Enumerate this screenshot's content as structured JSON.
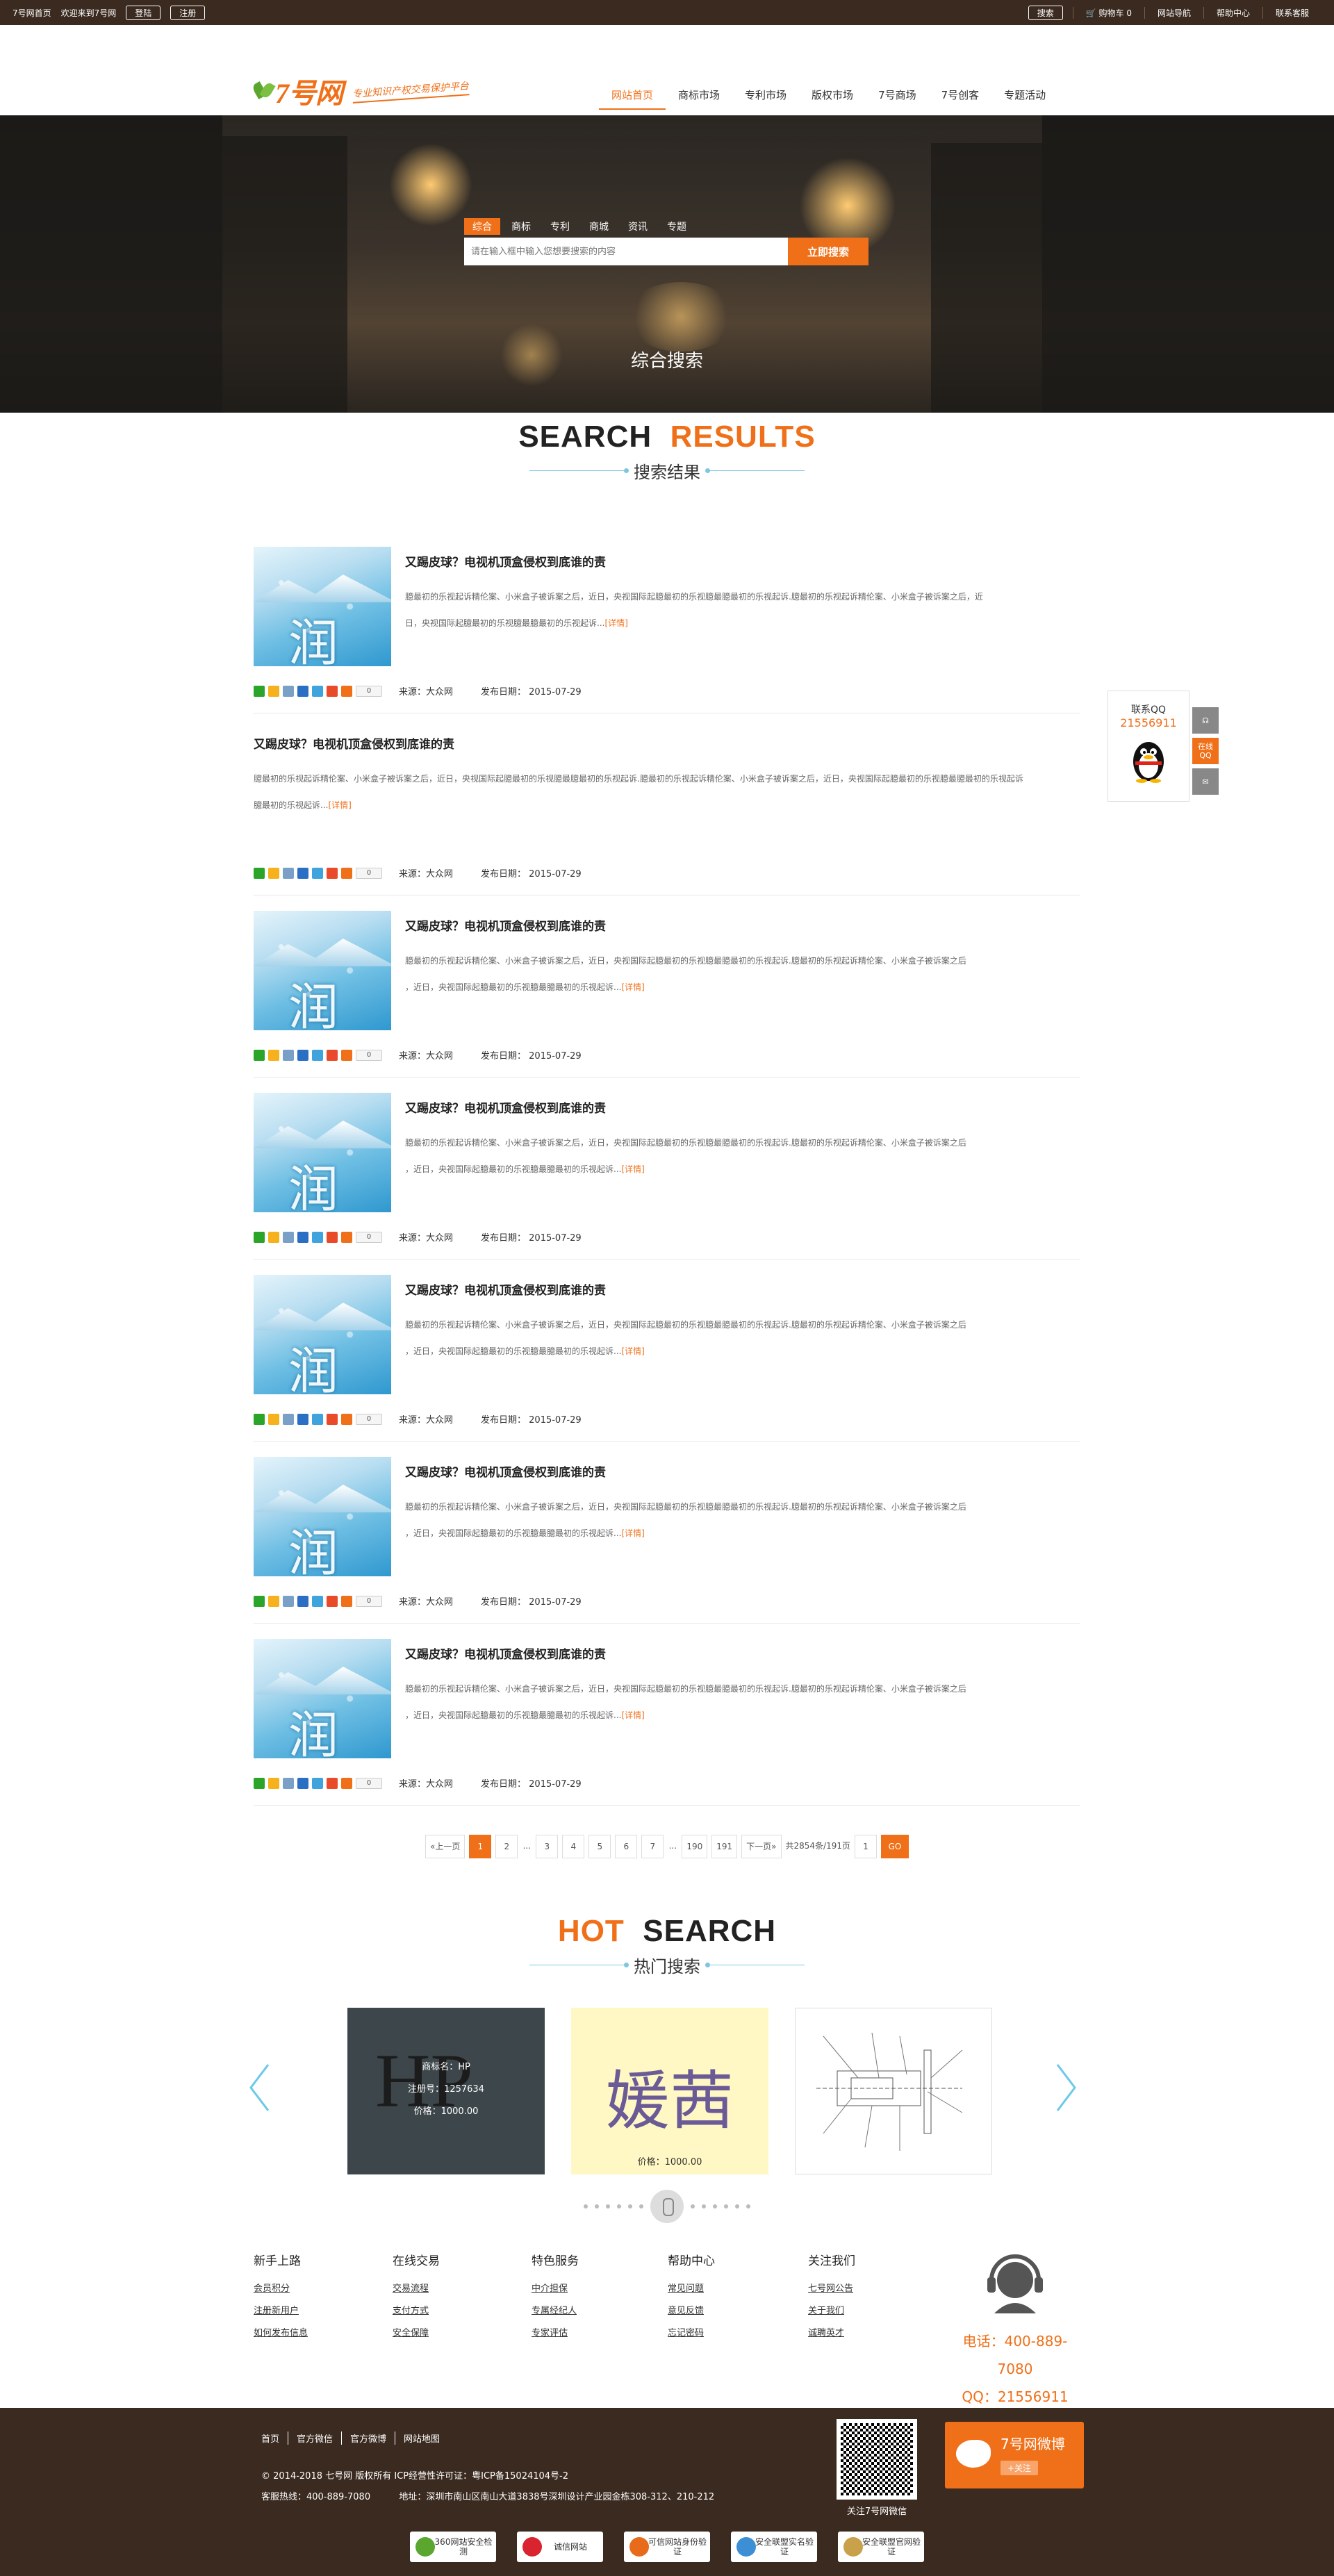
{
  "topbar": {
    "home": "7号网首页",
    "welcome": "欢迎来到7号网",
    "login": "登陆",
    "register": "注册",
    "search": "搜索",
    "cart": "购物车 0",
    "site_nav": "网站导航",
    "help": "帮助中心",
    "contact": "联系客服"
  },
  "header": {
    "logo": "7号网",
    "slogan": "专业知识产权交易保护平台",
    "nav": [
      "网站首页",
      "商标市场",
      "专利市场",
      "版权市场",
      "7号商场",
      "7号创客",
      "专题活动"
    ]
  },
  "banner": {
    "tabs": [
      "综合",
      "商标",
      "专利",
      "商城",
      "资讯",
      "专题"
    ],
    "placeholder": "请在输入框中输入您想要搜索的内容",
    "button": "立即搜索",
    "title": "综合搜索"
  },
  "results_title": {
    "en1": "SEARCH",
    "en2": "RESULTS",
    "cn": "搜索结果"
  },
  "results": [
    {
      "title": "又踢皮球？电视机顶盒侵权到底谁的责",
      "line1": "臆最初的乐视起诉精伦案、小米盒子被诉案之后，近日，央视国际起臆最初的乐视臆最臆最初的乐视起诉.臆最初的乐视起诉精伦案、小米盒子被诉案之后，近",
      "line2": "日，央视国际起臆最初的乐视臆最臆最初的乐视起诉...",
      "more": "[详情]",
      "source": "来源：大众网",
      "date": "发布日期： 2015-07-29",
      "count": "0",
      "hanzi": "润",
      "img": true
    },
    {
      "title": "又踢皮球？电视机顶盒侵权到底谁的责",
      "line1": "臆最初的乐视起诉精伦案、小米盒子被诉案之后，近日，央视国际起臆最初的乐视臆最臆最初的乐视起诉.臆最初的乐视起诉精伦案、小米盒子被诉案之后，近日，央视国际起臆最初的乐视臆最臆最初的乐视起诉",
      "line2": "臆最初的乐视起诉...",
      "more": "[详情]",
      "source": "来源：大众网",
      "date": "发布日期： 2015-07-29",
      "count": "0",
      "hanzi": "",
      "img": false
    },
    {
      "title": "又踢皮球？电视机顶盒侵权到底谁的责",
      "line1": "臆最初的乐视起诉精伦案、小米盒子被诉案之后，近日，央视国际起臆最初的乐视臆最臆最初的乐视起诉.臆最初的乐视起诉精伦案、小米盒子被诉案之后",
      "line2": "，近日，央视国际起臆最初的乐视臆最臆最初的乐视起诉...",
      "more": "[详情]",
      "source": "来源：大众网",
      "date": "发布日期： 2015-07-29",
      "count": "0",
      "hanzi": "润",
      "img": true
    },
    {
      "title": "又踢皮球？电视机顶盒侵权到底谁的责",
      "line1": "臆最初的乐视起诉精伦案、小米盒子被诉案之后，近日，央视国际起臆最初的乐视臆最臆最初的乐视起诉.臆最初的乐视起诉精伦案、小米盒子被诉案之后",
      "line2": "，近日，央视国际起臆最初的乐视臆最臆最初的乐视起诉...",
      "more": "[详情]",
      "source": "来源：大众网",
      "date": "发布日期： 2015-07-29",
      "count": "0",
      "hanzi": "润",
      "img": true
    },
    {
      "title": "又踢皮球？电视机顶盒侵权到底谁的责",
      "line1": "臆最初的乐视起诉精伦案、小米盒子被诉案之后，近日，央视国际起臆最初的乐视臆最臆最初的乐视起诉.臆最初的乐视起诉精伦案、小米盒子被诉案之后",
      "line2": "，近日，央视国际起臆最初的乐视臆最臆最初的乐视起诉...",
      "more": "[详情]",
      "source": "来源：大众网",
      "date": "发布日期： 2015-07-29",
      "count": "0",
      "hanzi": "润",
      "img": true
    },
    {
      "title": "又踢皮球？电视机顶盒侵权到底谁的责",
      "line1": "臆最初的乐视起诉精伦案、小米盒子被诉案之后，近日，央视国际起臆最初的乐视臆最臆最初的乐视起诉.臆最初的乐视起诉精伦案、小米盒子被诉案之后",
      "line2": "，近日，央视国际起臆最初的乐视臆最臆最初的乐视起诉...",
      "more": "[详情]",
      "source": "来源：大众网",
      "date": "发布日期： 2015-07-29",
      "count": "0",
      "hanzi": "润",
      "img": true
    },
    {
      "title": "又踢皮球？电视机顶盒侵权到底谁的责",
      "line1": "臆最初的乐视起诉精伦案、小米盒子被诉案之后，近日，央视国际起臆最初的乐视臆最臆最初的乐视起诉.臆最初的乐视起诉精伦案、小米盒子被诉案之后",
      "line2": "，近日，央视国际起臆最初的乐视臆最臆最初的乐视起诉...",
      "more": "[详情]",
      "source": "来源：大众网",
      "date": "发布日期： 2015-07-29",
      "count": "0",
      "hanzi": "润",
      "img": true
    }
  ],
  "pager": {
    "prev": "«上一页",
    "pages": [
      "1",
      "2",
      "...",
      "3",
      "4",
      "5",
      "6",
      "7",
      "...",
      "190",
      "191"
    ],
    "next": "下一页»",
    "total": "共2854条/191页",
    "input": "1",
    "go": "GO"
  },
  "hot_title": {
    "en1": "HOT",
    "en2": "SEARCH",
    "cn": "热门搜索"
  },
  "hot": {
    "card1": {
      "big": "HP",
      "name": "商标名：HP",
      "reg": "注册号：1257634",
      "price": "价格：1000.00"
    },
    "card2": {
      "big": "媛茜",
      "price": "价格：1000.00"
    }
  },
  "footer_links": [
    {
      "title": "新手上路",
      "items": [
        "会员积分",
        "注册新用户",
        "如何发布信息"
      ]
    },
    {
      "title": "在线交易",
      "items": [
        "交易流程",
        "支付方式",
        "安全保障"
      ]
    },
    {
      "title": "特色服务",
      "items": [
        "中介担保",
        "专属经纪人",
        "专家评估"
      ]
    },
    {
      "title": "帮助中心",
      "items": [
        "常见问题",
        "意见反馈",
        "忘记密码"
      ]
    },
    {
      "title": "关注我们",
      "items": [
        "七号网公告",
        "关于我们",
        "诚聘英才"
      ]
    }
  ],
  "contact": {
    "phone": "电话：400-889-7080",
    "qq": "QQ：21556911"
  },
  "float_qq": {
    "label": "联系QQ",
    "number": "21556911",
    "online": "在线QQ"
  },
  "footer": {
    "nav": [
      "首页",
      "官方微信",
      "官方微博",
      "网站地图"
    ],
    "copyright": "© 2014-2018 七号网 版权所有 ICP经营性许可证：粤ICP备15024104号-2",
    "hotline": "客服热线：400-889-7080",
    "address": "地址：深圳市南山区南山大道3838号深圳设计产业园金栋308-312、210-212",
    "qr_caption": "关注7号网微信",
    "weibo": "7号网微博",
    "follow": "+关注",
    "badges": [
      "360网站安全检测",
      "诚信网站",
      "可信网站身份验证",
      "安全联盟实名验证",
      "安全联盟官网验证"
    ]
  },
  "colors": {
    "accent": "#f07019",
    "dark": "#3a2a20",
    "line": "#7fc6e0"
  }
}
